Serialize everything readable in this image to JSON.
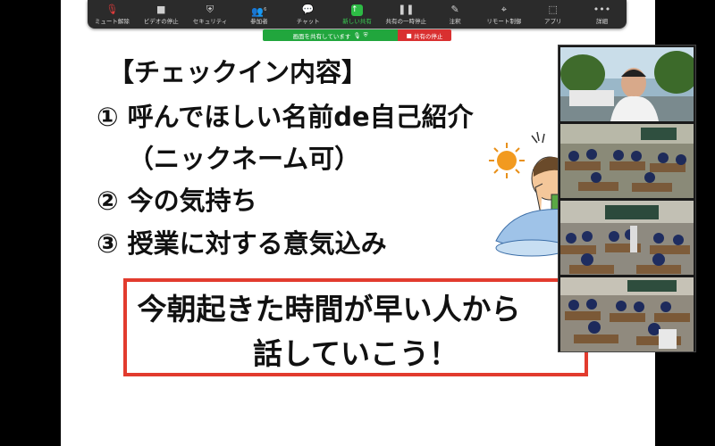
{
  "toolbar": {
    "items": [
      {
        "label": "ミュート解除",
        "icon": "microphone-muted-icon"
      },
      {
        "label": "ビデオの停止",
        "icon": "video-camera-icon"
      },
      {
        "label": "セキュリティ",
        "icon": "shield-icon"
      },
      {
        "label": "参加者",
        "icon": "participants-icon",
        "badge": "6"
      },
      {
        "label": "チャット",
        "icon": "chat-icon"
      },
      {
        "label": "新しい共有",
        "icon": "share-screen-icon"
      },
      {
        "label": "共有の一時停止",
        "icon": "pause-icon"
      },
      {
        "label": "注釈",
        "icon": "pencil-icon"
      },
      {
        "label": "リモート制御",
        "icon": "remote-control-icon"
      },
      {
        "label": "アプリ",
        "icon": "apps-icon"
      },
      {
        "label": "詳細",
        "icon": "more-icon"
      }
    ]
  },
  "share_banner": {
    "sharing_text": "画面を共有しています",
    "stop_text": "共有の停止"
  },
  "slide": {
    "title": "【チェックイン内容】",
    "item1": "① 呼んでほしい名前de自己紹介",
    "item1_sub": "（ニックネーム可）",
    "item2": "② 今の気持ち",
    "item3": "③ 授業に対する意気込み",
    "callout_line1": "今朝起きた時間が早い人から",
    "callout_line2": "話していこう！"
  },
  "colors": {
    "toolbar_bg": "#2b2b2b",
    "share_green": "#21a63d",
    "stop_red": "#d93030",
    "callout_border": "#e23b2e"
  }
}
